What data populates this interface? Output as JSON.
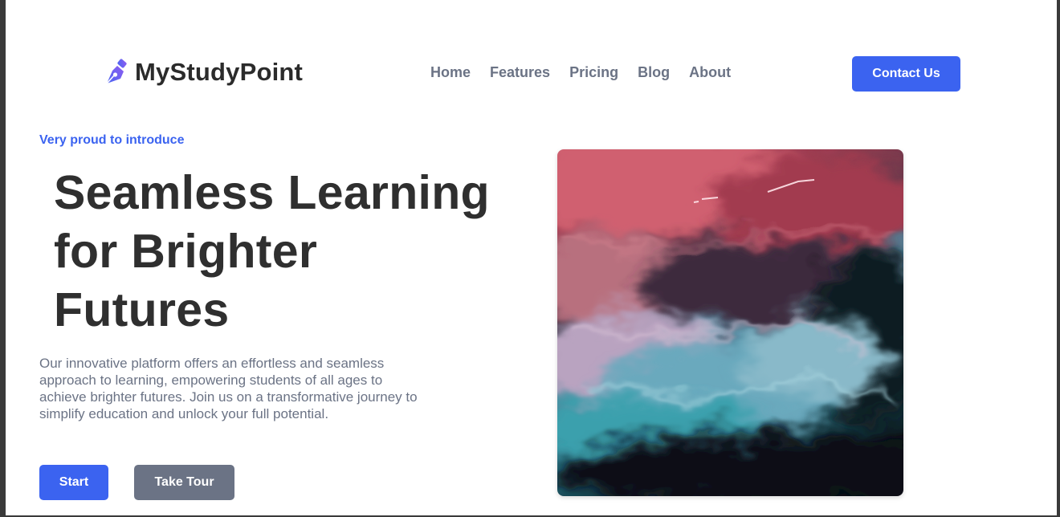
{
  "header": {
    "logo_text": "MyStudyPoint",
    "logo_icon": "pen-nib-icon",
    "nav": [
      {
        "label": "Home"
      },
      {
        "label": "Features"
      },
      {
        "label": "Pricing"
      },
      {
        "label": "Blog"
      },
      {
        "label": "About"
      }
    ],
    "contact_label": "Contact Us"
  },
  "hero": {
    "eyebrow": "Very proud to introduce",
    "title_lines": [
      "Seamless Learning",
      "for Brighter",
      "Futures"
    ],
    "description": "Our innovative platform offers an effortless and seamless approach to learning, empowering students of all ages to achieve brighter futures. Join us on a transformative journey to simplify education and unlock your full potential.",
    "start_label": "Start",
    "tour_label": "Take Tour",
    "image": "abstract-fluid-ink-image"
  },
  "colors": {
    "accent": "#3b63f0",
    "heading": "#2f2f2f",
    "muted": "#6b7385",
    "secondary_button": "#6b7385"
  }
}
